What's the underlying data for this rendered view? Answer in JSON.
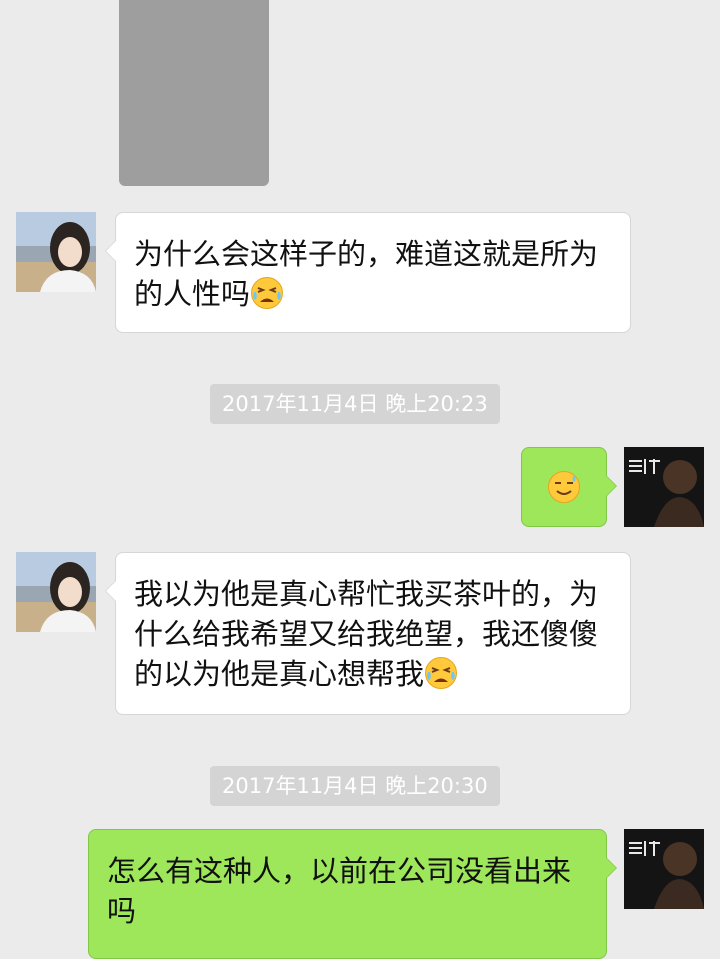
{
  "messages": [
    {
      "id": "m1",
      "direction": "in",
      "text": "为什么会这样子的，难道这就是所为的人性吗",
      "emoji": "crying-face-icon"
    },
    {
      "id": "m2",
      "direction": "out",
      "text": "",
      "emoji": "smiling-sweat-face-icon"
    },
    {
      "id": "m3",
      "direction": "in",
      "text": "我以为他是真心帮忙我买茶叶的，为什么给我希望又给我绝望，我还傻傻的以为他是真心想帮我",
      "emoji": "crying-face-icon"
    },
    {
      "id": "m4",
      "direction": "out",
      "text": "怎么有这种人，以前在公司没看出来吗"
    }
  ],
  "timestamps": [
    "2017年11月4日 晚上20:23",
    "2017年11月4日 晚上20:30"
  ],
  "colors": {
    "background": "#ebebeb",
    "incoming_bubble": "#ffffff",
    "outgoing_bubble": "#9ee65a",
    "timestamp_bg": "#d4d4d4",
    "timestamp_text": "#ffffff"
  }
}
